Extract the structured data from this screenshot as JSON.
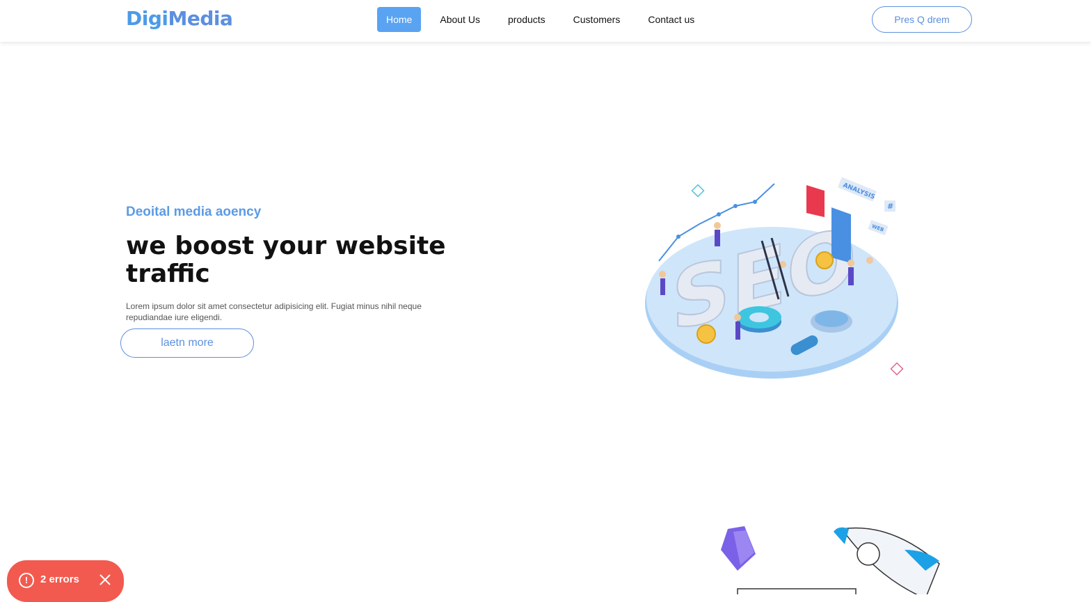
{
  "header": {
    "logo": {
      "part1": "Digi",
      "part2": "Media"
    },
    "nav": [
      {
        "label": "Home",
        "active": true
      },
      {
        "label": "About Us",
        "active": false
      },
      {
        "label": "products",
        "active": false
      },
      {
        "label": "Customers",
        "active": false
      },
      {
        "label": "Contact us",
        "active": false
      }
    ],
    "cta_label": "Pres Q drem"
  },
  "hero": {
    "subtitle": "Deoital media aoency",
    "title": "we boost your website traffic",
    "text": "Lorem ipsum dolor sit amet consectetur adipisicing elit. Fugiat minus nihil neque repudiandae iure eligendi.",
    "button_label": "laetn more",
    "illustration": {
      "big_text": "SEO",
      "tags": [
        "ANALYSIS",
        "#",
        "WEB"
      ]
    }
  },
  "error_badge": {
    "label": "2 errors",
    "icon": "alert-circle-icon",
    "close_icon": "close-icon"
  },
  "colors": {
    "accent": "#5b8fe0",
    "nav_active_bg": "#5aa3f2",
    "error_bg": "#f25a4f"
  }
}
